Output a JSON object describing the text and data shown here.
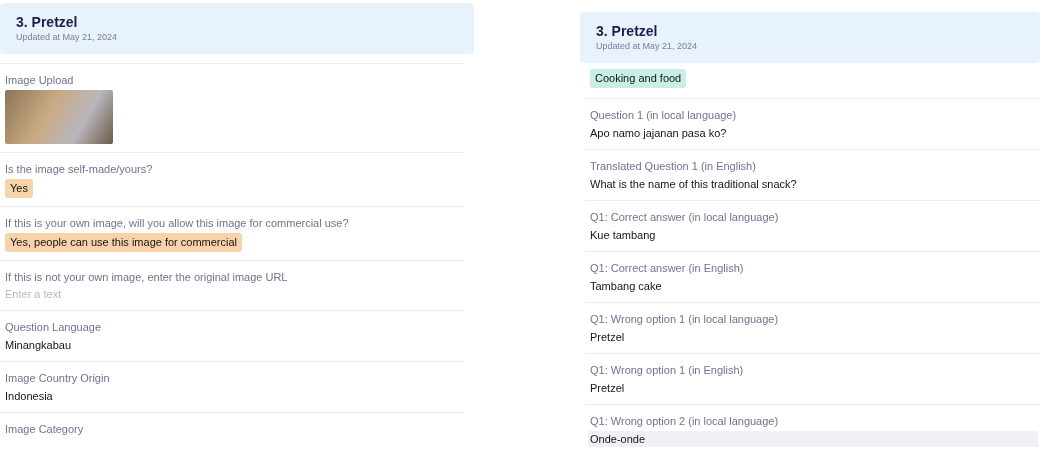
{
  "panels": [
    {
      "title": "3. Pretzel",
      "updated": "Updated at May 21, 2024",
      "fields": [
        {
          "kind": "image",
          "label": "Image Upload",
          "highlighted": false
        },
        {
          "kind": "tag",
          "label": "Is the image self-made/yours?",
          "value": "Yes",
          "color": "#f8d3a9",
          "highlighted": false
        },
        {
          "kind": "tag",
          "label": "If this is your own image, will you allow this image for commercial use?",
          "value": "Yes, people can use this image for commercial",
          "color": "#f8d3a9",
          "highlighted": false
        },
        {
          "kind": "input",
          "label": "If this is not your own image, enter the original image URL",
          "placeholder": "Enter a text",
          "highlighted": false
        },
        {
          "kind": "text",
          "label": "Question Language",
          "value": "Minangkabau",
          "highlighted": false
        },
        {
          "kind": "text",
          "label": "Image Country Origin",
          "value": "Indonesia",
          "highlighted": false
        },
        {
          "kind": "text",
          "label": "Image Category",
          "highlighted": false
        }
      ]
    },
    {
      "title": "3. Pretzel",
      "updated": "Updated at May 21, 2024",
      "fields": [
        {
          "kind": "tag",
          "value": "Cooking and food",
          "color": "#c8eee5",
          "highlighted": false
        },
        {
          "kind": "text",
          "label": "Question 1 (in local language)",
          "value": "Apo namo jajanan pasa ko?",
          "highlighted": false
        },
        {
          "kind": "text",
          "label": "Translated Question 1 (in English)",
          "value": "What is the name of this traditional snack?",
          "highlighted": false
        },
        {
          "kind": "text",
          "label": "Q1: Correct answer (in local language)",
          "value": "Kue tambang",
          "highlighted": false
        },
        {
          "kind": "text",
          "label": "Q1: Correct answer (in English)",
          "value": "Tambang cake",
          "highlighted": false
        },
        {
          "kind": "text",
          "label": "Q1: Wrong option 1 (in local language)",
          "value": "Pretzel",
          "highlighted": false
        },
        {
          "kind": "text",
          "label": "Q1: Wrong option 1 (in English)",
          "value": "Pretzel",
          "highlighted": false
        },
        {
          "kind": "text",
          "label": "Q1: Wrong option 2 (in local language)",
          "value": "Onde-onde",
          "highlighted": true
        }
      ]
    }
  ]
}
